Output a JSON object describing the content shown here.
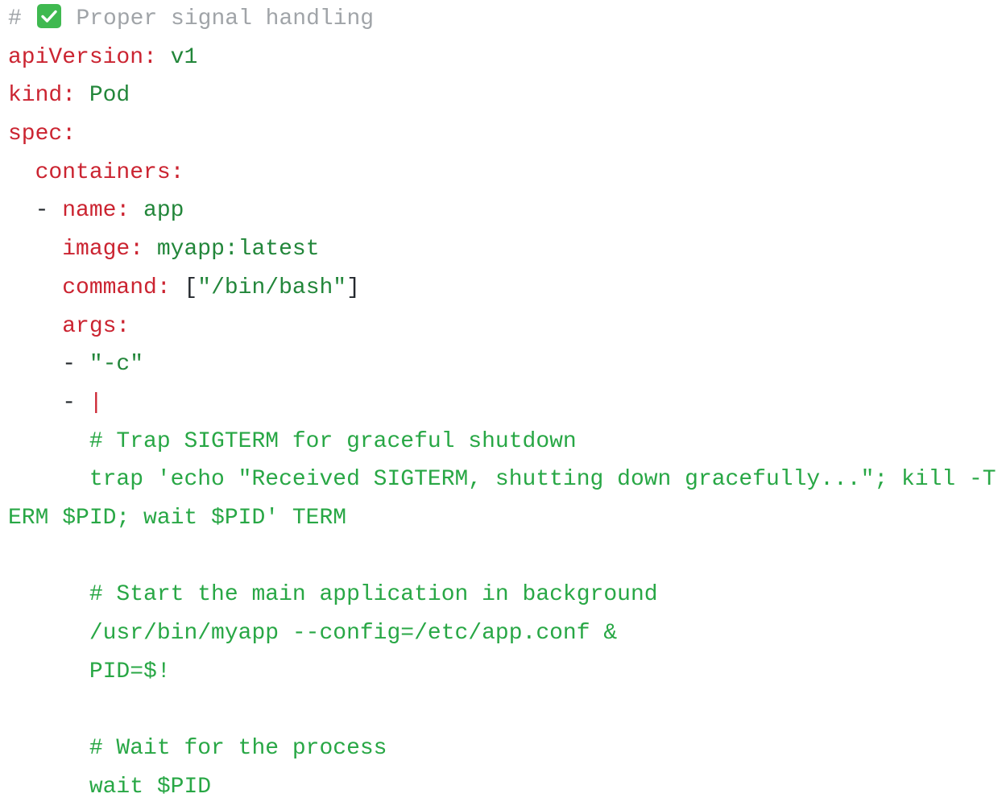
{
  "code": {
    "comment_hash": "#",
    "check_icon": "white-check-mark",
    "comment_text": "Proper signal handling",
    "lines": {
      "apiVersion_key": "apiVersion:",
      "apiVersion_val": "v1",
      "kind_key": "kind:",
      "kind_val": "Pod",
      "spec_key": "spec:",
      "containers_key": "containers:",
      "name_dash": "- ",
      "name_key": "name:",
      "name_val": "app",
      "image_key": "image:",
      "image_val": "myapp:latest",
      "command_key": "command:",
      "command_open": "[",
      "command_val": "\"/bin/bash\"",
      "command_close": "]",
      "args_key": "args:",
      "arg1_dash": "- ",
      "arg1_val": "\"-c\"",
      "arg2_dash": "- ",
      "arg2_pipe": "|",
      "script_comment_1": "# Trap SIGTERM for graceful shutdown",
      "script_trap_a": "trap 'echo \"Received SIGTERM, shutting down gracefully...\"; kill -T",
      "script_trap_b": "ERM $PID; wait $PID' TERM",
      "script_comment_2": "# Start the main application in background",
      "script_start": "/usr/bin/myapp --config=/etc/app.conf &",
      "script_pid": "PID=$!",
      "script_comment_3": "# Wait for the process",
      "script_wait": "wait $PID"
    }
  },
  "colors": {
    "comment": "#a0a4a8",
    "key": "#cb2431",
    "value": "#22863a",
    "plain": "#24292e",
    "block": "#28a745",
    "check_bg": "#3fb950"
  }
}
